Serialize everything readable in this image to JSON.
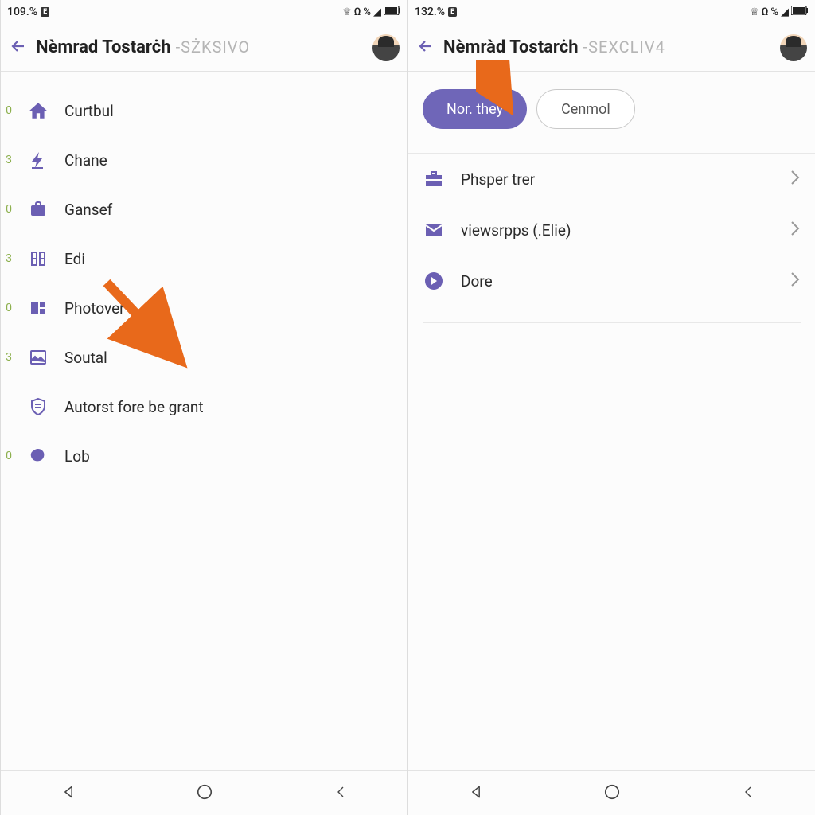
{
  "left": {
    "status": {
      "time": "109.%",
      "badge": "E"
    },
    "header": {
      "title": "Nèmrad Tostarċh",
      "subtitle": "-SŻKSIVO"
    },
    "menu": [
      {
        "count": "0",
        "label": "Curtbul",
        "icon": "home"
      },
      {
        "count": "3",
        "label": "Chane",
        "icon": "bolt"
      },
      {
        "count": "0",
        "label": "Gansef",
        "icon": "briefcase"
      },
      {
        "count": "3",
        "label": "Edi",
        "icon": "columns"
      },
      {
        "count": "0",
        "label": "Photover",
        "icon": "panel"
      },
      {
        "count": "3",
        "label": "Soutal",
        "icon": "image"
      },
      {
        "count": "",
        "label": "Autorst fore be grant",
        "icon": "shield"
      },
      {
        "count": "0",
        "label": "Lob",
        "icon": "blob"
      }
    ]
  },
  "right": {
    "status": {
      "time": "132.%",
      "badge": "E"
    },
    "header": {
      "title": "Nèmràd Tostarċh",
      "subtitle": "-SEXCLIV4"
    },
    "pills": {
      "primary": "Nor. they",
      "secondary": "Cenmol"
    },
    "options": [
      {
        "label": "Phsper trer",
        "icon": "toolbox"
      },
      {
        "label": "viewsrpps (.Elie)",
        "icon": "mail"
      },
      {
        "label": "Dore",
        "icon": "circle-arrow"
      }
    ]
  }
}
